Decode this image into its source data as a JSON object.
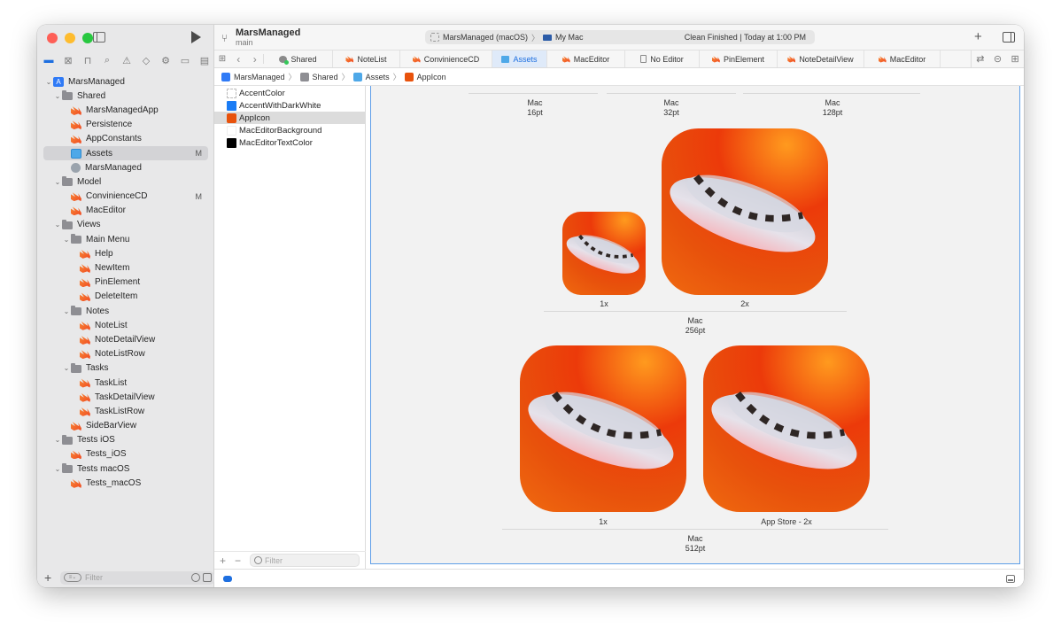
{
  "window": {
    "traffic_lights": {
      "close": "#fe5f57",
      "minimize": "#febc2e",
      "maximize": "#28c840"
    }
  },
  "toolbar": {
    "project_name": "MarsManaged",
    "branch": "main",
    "scheme": "MarsManaged (macOS)",
    "destination": "My Mac",
    "status": "Clean Finished | Today at 1:00 PM"
  },
  "navigator_icons": [
    "folder-icon",
    "source-control-icon",
    "hierarchy-icon",
    "search-icon",
    "warning-icon",
    "test-icon",
    "debug-icon",
    "breakpoint-icon",
    "report-icon"
  ],
  "tree": [
    {
      "label": "MarsManaged",
      "type": "project",
      "depth": 0,
      "chevron": true
    },
    {
      "label": "Shared",
      "type": "folder",
      "depth": 1,
      "chevron": true
    },
    {
      "label": "MarsManagedApp",
      "type": "swift",
      "depth": 2
    },
    {
      "label": "Persistence",
      "type": "swift",
      "depth": 2
    },
    {
      "label": "AppConstants",
      "type": "swift",
      "depth": 2
    },
    {
      "label": "Assets",
      "type": "assets",
      "depth": 2,
      "selected": true,
      "badge": "M"
    },
    {
      "label": "MarsManaged",
      "type": "xcdatamodel",
      "depth": 2
    },
    {
      "label": "Model",
      "type": "folder",
      "depth": 1,
      "chevron": true
    },
    {
      "label": "ConvinienceCD",
      "type": "swift",
      "depth": 2,
      "badge": "M"
    },
    {
      "label": "MacEditor",
      "type": "swift",
      "depth": 2
    },
    {
      "label": "Views",
      "type": "folder",
      "depth": 1,
      "chevron": true
    },
    {
      "label": "Main Menu",
      "type": "folder",
      "depth": 2,
      "chevron": true
    },
    {
      "label": "Help",
      "type": "swift",
      "depth": 3
    },
    {
      "label": "NewItem",
      "type": "swift",
      "depth": 3
    },
    {
      "label": "PinElement",
      "type": "swift",
      "depth": 3
    },
    {
      "label": "DeleteItem",
      "type": "swift",
      "depth": 3
    },
    {
      "label": "Notes",
      "type": "folder",
      "depth": 2,
      "chevron": true
    },
    {
      "label": "NoteList",
      "type": "swift",
      "depth": 3
    },
    {
      "label": "NoteDetailView",
      "type": "swift",
      "depth": 3
    },
    {
      "label": "NoteListRow",
      "type": "swift",
      "depth": 3
    },
    {
      "label": "Tasks",
      "type": "folder",
      "depth": 2,
      "chevron": true
    },
    {
      "label": "TaskList",
      "type": "swift",
      "depth": 3
    },
    {
      "label": "TaskDetailView",
      "type": "swift",
      "depth": 3
    },
    {
      "label": "TaskListRow",
      "type": "swift",
      "depth": 3
    },
    {
      "label": "SideBarView",
      "type": "swift",
      "depth": 2
    },
    {
      "label": "Tests iOS",
      "type": "folder",
      "depth": 1,
      "chevron": true
    },
    {
      "label": "Tests_iOS",
      "type": "swift",
      "depth": 2
    },
    {
      "label": "Tests macOS",
      "type": "folder",
      "depth": 1,
      "chevron": true
    },
    {
      "label": "Tests_macOS",
      "type": "swift",
      "depth": 2
    }
  ],
  "sidebar_filter": {
    "placeholder": "Filter"
  },
  "tabs": [
    {
      "label": "Shared",
      "icon": "shared",
      "width": 78
    },
    {
      "label": "NoteList",
      "icon": "swift",
      "width": 76
    },
    {
      "label": "ConvinienceCD",
      "icon": "swift",
      "width": 104
    },
    {
      "label": "Assets",
      "icon": "assets",
      "active": true,
      "width": 62
    },
    {
      "label": "MacEditor",
      "icon": "swift",
      "width": 88
    },
    {
      "label": "No Editor",
      "icon": "noeditor",
      "width": 84
    },
    {
      "label": "PinElement",
      "icon": "swift",
      "width": 88
    },
    {
      "label": "NoteDetailView",
      "icon": "swift",
      "width": 98
    },
    {
      "label": "MacEditor",
      "icon": "swift",
      "width": 86
    }
  ],
  "jumpbar": [
    "MarsManaged",
    "Shared",
    "Assets",
    "AppIcon"
  ],
  "assets": [
    {
      "label": "AccentColor",
      "swatch": "dashed"
    },
    {
      "label": "AccentWithDarkWhite",
      "swatch": "#1a7cf5"
    },
    {
      "label": "AppIcon",
      "swatch": "appicon",
      "selected": true
    },
    {
      "label": "MacEditorBackground",
      "swatch": "#ffffff"
    },
    {
      "label": "MacEditorTextColor",
      "swatch": "#000000"
    }
  ],
  "asset_filter": {
    "placeholder": "Filter"
  },
  "icon_groups": {
    "top": [
      {
        "platform": "Mac",
        "size": "16pt"
      },
      {
        "platform": "Mac",
        "size": "32pt"
      },
      {
        "platform": "Mac",
        "size": "128pt"
      }
    ],
    "mid": {
      "platform": "Mac",
      "size": "256pt",
      "slots": [
        "1x",
        "2x"
      ]
    },
    "bottom": {
      "platform": "Mac",
      "size": "512pt",
      "slots": [
        "1x",
        "App Store - 2x"
      ]
    }
  }
}
